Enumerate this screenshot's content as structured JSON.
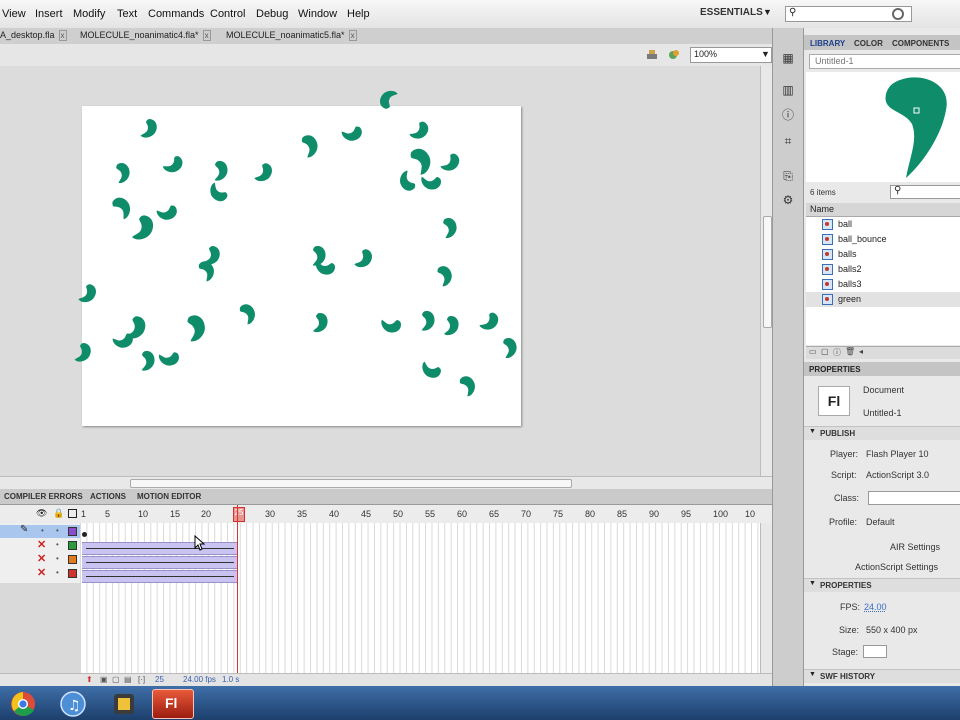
{
  "menubar": {
    "items": [
      "View",
      "Insert",
      "Modify",
      "Text",
      "Commands",
      "Control",
      "Debug",
      "Window",
      "Help"
    ],
    "workspace": "ESSENTIALS"
  },
  "doc_tabs": [
    "A_desktop.fla",
    "MOLECULE_noanimatic4.fla*",
    "MOLECULE_noanimatic5.fla*"
  ],
  "editbar": {
    "zoom": "100%"
  },
  "stage": {
    "color": "#ffffff",
    "shape_color": "#0f8c6a"
  },
  "bottom_tabs": [
    "COMPILER ERRORS",
    "ACTIONS",
    "MOTION EDITOR"
  ],
  "timeline": {
    "frame_numbers": [
      "1",
      "5",
      "10",
      "15",
      "20",
      "25",
      "30",
      "35",
      "40",
      "45",
      "50",
      "55",
      "60",
      "65",
      "70",
      "75",
      "80",
      "85",
      "90",
      "95",
      "100",
      "10"
    ],
    "current_frame": "25",
    "layer_colors": [
      "#8b4dc9",
      "#2e9a3e",
      "#e27a1b",
      "#d0342c"
    ],
    "footer": {
      "frame": "25",
      "fps": "24.00 fps",
      "time": "1.0 s"
    }
  },
  "library": {
    "tabs": [
      "LIBRARY",
      "COLOR",
      "COMPONENTS"
    ],
    "document": "Untitled-1",
    "item_count": "6 items",
    "column_name": "Name",
    "items": [
      "ball",
      "ball_bounce",
      "balls",
      "balls2",
      "balls3",
      "green"
    ],
    "selected": "green"
  },
  "properties": {
    "header": "PROPERTIES",
    "doc_type": "Document",
    "doc_name": "Untitled-1",
    "publish_section": "PUBLISH",
    "player_label": "Player:",
    "player_value": "Flash Player 10",
    "script_label": "Script:",
    "script_value": "ActionScript 3.0",
    "class_label": "Class:",
    "profile_label": "Profile:",
    "profile_value": "Default",
    "air_settings": "AIR Settings",
    "as_settings": "ActionScript Settings",
    "props_section": "PROPERTIES",
    "fps_label": "FPS:",
    "fps_value": "24.00",
    "size_label": "Size:",
    "size_value": "550 x 400 px",
    "stage_label": "Stage:",
    "swf_section": "SWF HISTORY"
  }
}
